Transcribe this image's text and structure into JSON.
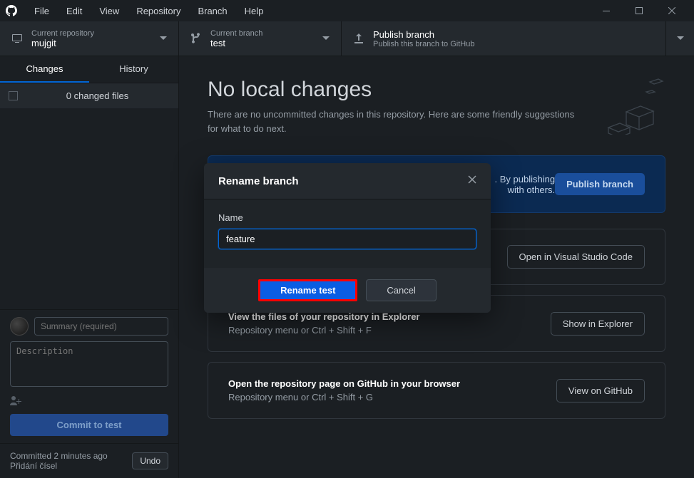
{
  "menu": {
    "file": "File",
    "edit": "Edit",
    "view": "View",
    "repository": "Repository",
    "branch": "Branch",
    "help": "Help"
  },
  "toolbar": {
    "repo": {
      "label": "Current repository",
      "value": "mujgit"
    },
    "branch": {
      "label": "Current branch",
      "value": "test"
    },
    "publish": {
      "label": "Publish branch",
      "value": "Publish this branch to GitHub"
    }
  },
  "tabs": {
    "changes": "Changes",
    "history": "History"
  },
  "changes": {
    "count_label": "0 changed files"
  },
  "commit": {
    "summary_placeholder": "Summary (required)",
    "desc_placeholder": "Description",
    "button": "Commit to test",
    "meta_line1": "Committed 2 minutes ago",
    "meta_line2": "Přidání čísel",
    "undo": "Undo"
  },
  "content": {
    "headline": "No local changes",
    "subhead": "There are no uncommitted changes in this repository. Here are some friendly suggestions for what to do next.",
    "publish_card": {
      "tail1": ". By publishing",
      "tail2": "with others.",
      "action": "Publish branch"
    },
    "vscode_card": {
      "action": "Open in Visual Studio Code"
    },
    "explorer_card": {
      "title": "View the files of your repository in Explorer",
      "sub_prefix": "Repository menu or  ",
      "shortcut": "Ctrl + Shift + F",
      "action": "Show in Explorer"
    },
    "github_card": {
      "title": "Open the repository page on GitHub in your browser",
      "sub_prefix": "Repository menu or  ",
      "shortcut": "Ctrl + Shift + G",
      "action": "View on GitHub"
    }
  },
  "modal": {
    "title": "Rename branch",
    "field_label": "Name",
    "input_value": "feature",
    "submit": "Rename test",
    "cancel": "Cancel"
  }
}
